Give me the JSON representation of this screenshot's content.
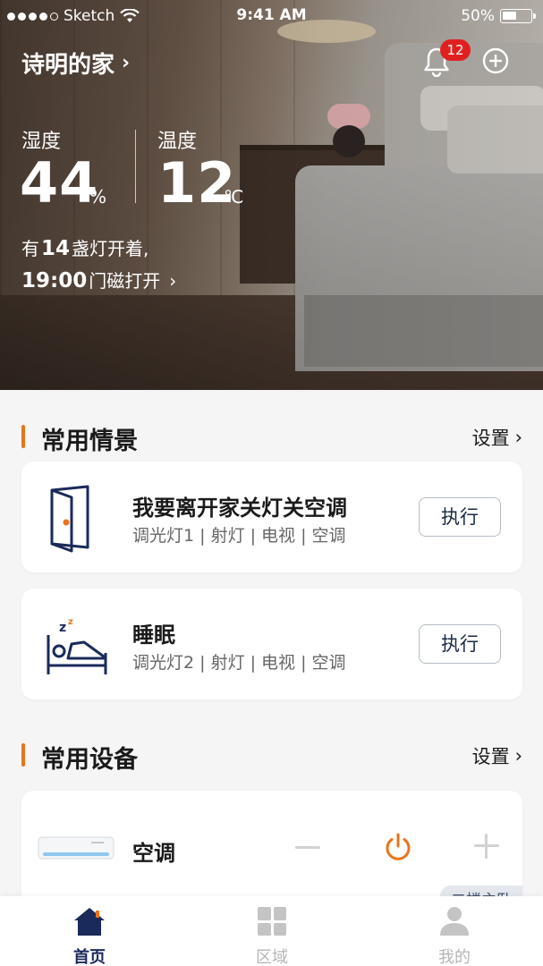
{
  "status_bar": {
    "carrier": "Sketch",
    "time": "9:41 AM",
    "battery": "50%",
    "battery_level": 0.5
  },
  "header": {
    "home_name": "诗明的家",
    "notification_count": "12"
  },
  "stats": {
    "humidity": {
      "label": "湿度",
      "value": "44",
      "unit": "%"
    },
    "temperature": {
      "label": "温度",
      "value": "12",
      "unit": "℃"
    }
  },
  "summary": {
    "line1_prefix": "有",
    "lights_count": "14",
    "line1_suffix": "盏灯开着,",
    "door_time": "19:00",
    "line2_suffix": "门磁打开"
  },
  "scenes_section": {
    "title": "常用情景",
    "action": "设置"
  },
  "scenes": [
    {
      "title": "我要离开家关灯关空调",
      "subtitle": "调光灯1 | 射灯 | 电视 | 空调",
      "button": "执行",
      "icon": "door-icon"
    },
    {
      "title": "睡眠",
      "subtitle": "调光灯2 | 射灯 | 电视 | 空调",
      "button": "执行",
      "icon": "sleep-bed-icon"
    }
  ],
  "devices_section": {
    "title": "常用设备",
    "action": "设置"
  },
  "devices": [
    {
      "name": "空调",
      "room": "二楼主卧",
      "icon": "air-conditioner-icon"
    }
  ],
  "tabs": [
    {
      "label": "首页",
      "icon": "home-icon",
      "active": true
    },
    {
      "label": "区域",
      "icon": "grid-icon",
      "active": false
    },
    {
      "label": "我的",
      "icon": "user-icon",
      "active": false
    }
  ],
  "colors": {
    "accent": "#e8741c",
    "navy": "#1a2a5a",
    "badge": "#e02020"
  }
}
